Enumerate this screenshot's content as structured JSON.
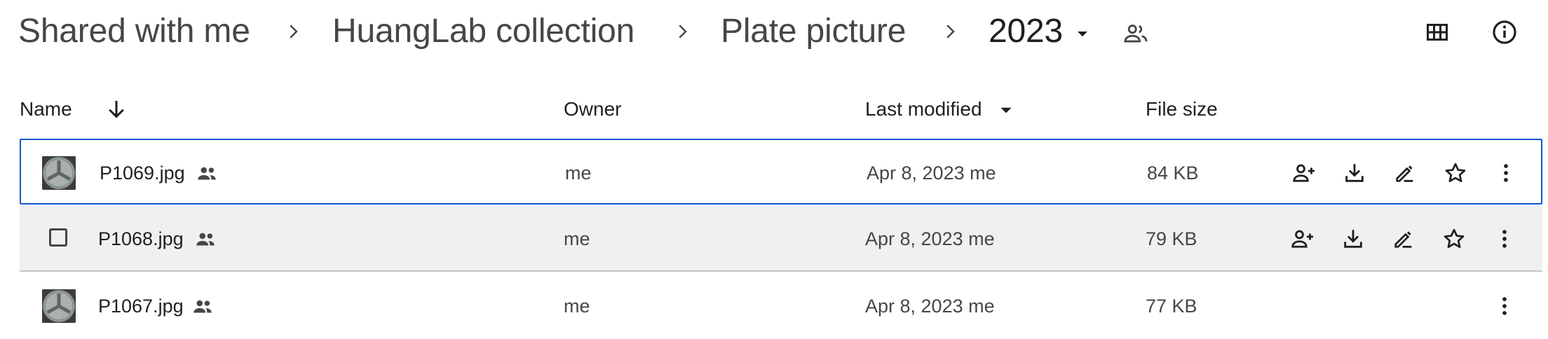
{
  "breadcrumb": {
    "items": [
      "Shared with me",
      "HuangLab collection",
      "Plate picture"
    ],
    "current": "2023"
  },
  "header_icons": [
    "people-icon",
    "grid-view-icon",
    "info-icon"
  ],
  "columns": {
    "name": "Name",
    "owner": "Owner",
    "last_modified": "Last modified",
    "file_size": "File size"
  },
  "rows": [
    {
      "name": "P1069.jpg",
      "owner": "me",
      "modified": "Apr 8, 2023 me",
      "size": "84 KB",
      "state": "selected"
    },
    {
      "name": "P1068.jpg",
      "owner": "me",
      "modified": "Apr 8, 2023 me",
      "size": "79 KB",
      "state": "hover"
    },
    {
      "name": "P1067.jpg",
      "owner": "me",
      "modified": "Apr 8, 2023 me",
      "size": "77 KB",
      "state": "normal"
    }
  ],
  "row_actions": [
    "share-icon",
    "download-icon",
    "rename-icon",
    "star-icon",
    "more-vert-icon"
  ],
  "colors": {
    "selected_border": "#0b57d0",
    "hover_background": "#f0f0f0",
    "text_primary": "#1f1f1f",
    "text_secondary": "#444746"
  }
}
